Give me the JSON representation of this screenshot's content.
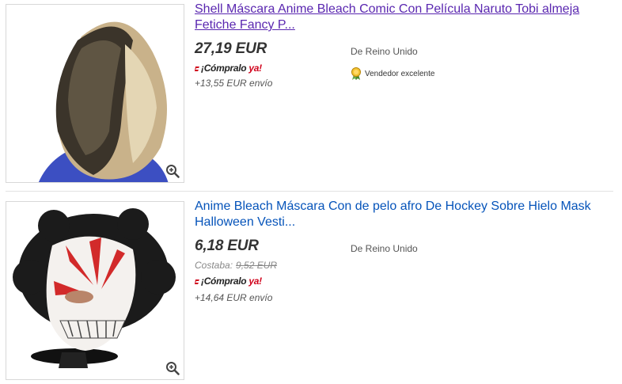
{
  "listings": [
    {
      "title": "Shell Máscara Anime Bleach Comic Con Película Naruto Tobi almeja Fetiche Fancy P...",
      "price": "27,19 EUR",
      "buy_now": {
        "prefix": "¡Cómpralo",
        "emphasis": "ya!"
      },
      "shipping": "+13,55 EUR envío",
      "location": "De Reino Unido",
      "seller_badge": "Vendedor excelente",
      "zoom_icon": "magnifier-plus-icon"
    },
    {
      "title": "Anime Bleach Máscara Con de pelo afro De Hockey Sobre Hielo Mask Halloween Vesti...",
      "price": "6,18 EUR",
      "was_label": "Costaba:",
      "was_price": "9,52 EUR",
      "buy_now": {
        "prefix": "¡Cómpralo",
        "emphasis": "ya!"
      },
      "shipping": "+14,64 EUR envío",
      "location": "De Reino Unido",
      "zoom_icon": "magnifier-plus-icon"
    }
  ],
  "colors": {
    "link": "#0654ba",
    "visited_link": "#5a27b0",
    "buy_now_accent": "#d0021b"
  }
}
